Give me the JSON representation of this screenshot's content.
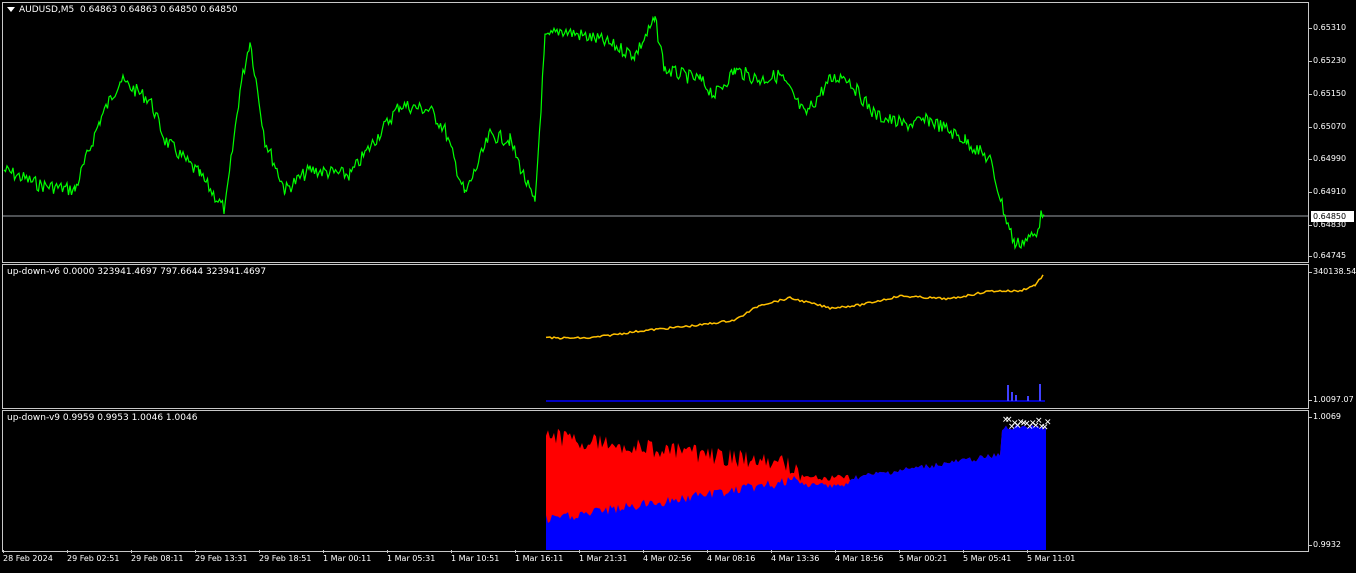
{
  "main": {
    "symbol": "AUDUSD,M5",
    "ohlc": "0.64863 0.64863 0.64850 0.64850",
    "current_price": "0.64850",
    "price_ticks": [
      "0.65310",
      "0.65230",
      "0.65150",
      "0.65070",
      "0.64990",
      "0.64910",
      "0.64830",
      "0.64745"
    ]
  },
  "ind1": {
    "title": "up-down-v6 0.0000 323941.4697 797.6644 323941.4697",
    "ticks": [
      "340138.54",
      "1.0097.07"
    ]
  },
  "ind2": {
    "title": "up-down-v9 0.9959 0.9953 1.0046 1.0046",
    "ticks": [
      "1.0069",
      "0.9932"
    ]
  },
  "time_axis": [
    "28 Feb 2024",
    "29 Feb 02:51",
    "29 Feb 08:11",
    "29 Feb 13:31",
    "29 Feb 18:51",
    "1 Mar 00:11",
    "1 Mar 05:31",
    "1 Mar 10:51",
    "1 Mar 16:11",
    "1 Mar 21:31",
    "4 Mar 02:56",
    "4 Mar 08:16",
    "4 Mar 13:36",
    "4 Mar 18:56",
    "5 Mar 00:21",
    "5 Mar 05:41",
    "5 Mar 11:01"
  ],
  "colors": {
    "price_line": "#00ff00",
    "ind1_line": "#ffc000",
    "bull_area": "#0000ff",
    "bear_area": "#ff0000",
    "marker": "#ffffff"
  },
  "icons": {
    "menu": "chevron-down-icon"
  }
}
